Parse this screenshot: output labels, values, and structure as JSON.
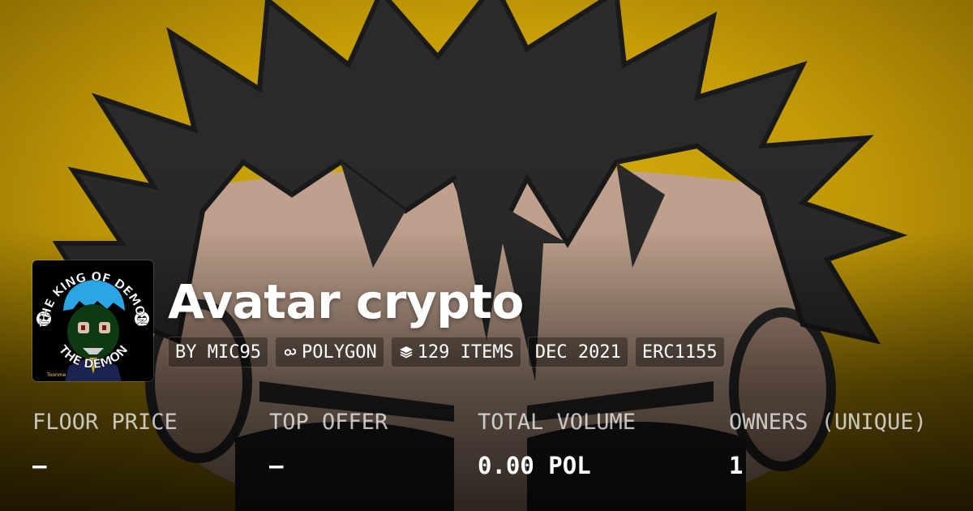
{
  "collection": {
    "title": "Avatar crypto",
    "logo_text_top": "THE KING OF DEMON",
    "logo_text_bottom": "THE DEMON",
    "logo_watermark": "Toonme",
    "chips": [
      {
        "label": "BY MIC95",
        "icon": ""
      },
      {
        "label": "POLYGON",
        "icon": "polygon-icon"
      },
      {
        "label": "129 ITEMS",
        "icon": "layers-icon"
      },
      {
        "label": "DEC 2021",
        "icon": ""
      },
      {
        "label": "ERC1155",
        "icon": ""
      }
    ]
  },
  "stats": [
    {
      "label": "FLOOR PRICE",
      "value": "—"
    },
    {
      "label": "TOP OFFER",
      "value": "—"
    },
    {
      "label": "TOTAL VOLUME",
      "value": "0.00 POL"
    },
    {
      "label": "OWNERS (UNIQUE)",
      "value": "1"
    }
  ],
  "colors": {
    "background_gold": "#c9a20a",
    "hair": "#2a2a2a",
    "skin": "#c8a890"
  }
}
